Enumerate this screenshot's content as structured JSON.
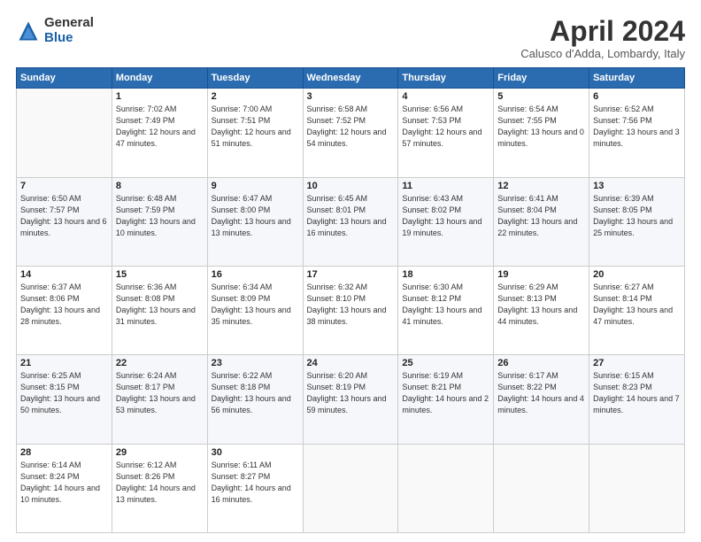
{
  "logo": {
    "general": "General",
    "blue": "Blue"
  },
  "header": {
    "month": "April 2024",
    "location": "Calusco d'Adda, Lombardy, Italy"
  },
  "weekdays": [
    "Sunday",
    "Monday",
    "Tuesday",
    "Wednesday",
    "Thursday",
    "Friday",
    "Saturday"
  ],
  "weeks": [
    [
      {
        "day": "",
        "sunrise": "",
        "sunset": "",
        "daylight": ""
      },
      {
        "day": "1",
        "sunrise": "Sunrise: 7:02 AM",
        "sunset": "Sunset: 7:49 PM",
        "daylight": "Daylight: 12 hours and 47 minutes."
      },
      {
        "day": "2",
        "sunrise": "Sunrise: 7:00 AM",
        "sunset": "Sunset: 7:51 PM",
        "daylight": "Daylight: 12 hours and 51 minutes."
      },
      {
        "day": "3",
        "sunrise": "Sunrise: 6:58 AM",
        "sunset": "Sunset: 7:52 PM",
        "daylight": "Daylight: 12 hours and 54 minutes."
      },
      {
        "day": "4",
        "sunrise": "Sunrise: 6:56 AM",
        "sunset": "Sunset: 7:53 PM",
        "daylight": "Daylight: 12 hours and 57 minutes."
      },
      {
        "day": "5",
        "sunrise": "Sunrise: 6:54 AM",
        "sunset": "Sunset: 7:55 PM",
        "daylight": "Daylight: 13 hours and 0 minutes."
      },
      {
        "day": "6",
        "sunrise": "Sunrise: 6:52 AM",
        "sunset": "Sunset: 7:56 PM",
        "daylight": "Daylight: 13 hours and 3 minutes."
      }
    ],
    [
      {
        "day": "7",
        "sunrise": "Sunrise: 6:50 AM",
        "sunset": "Sunset: 7:57 PM",
        "daylight": "Daylight: 13 hours and 6 minutes."
      },
      {
        "day": "8",
        "sunrise": "Sunrise: 6:48 AM",
        "sunset": "Sunset: 7:59 PM",
        "daylight": "Daylight: 13 hours and 10 minutes."
      },
      {
        "day": "9",
        "sunrise": "Sunrise: 6:47 AM",
        "sunset": "Sunset: 8:00 PM",
        "daylight": "Daylight: 13 hours and 13 minutes."
      },
      {
        "day": "10",
        "sunrise": "Sunrise: 6:45 AM",
        "sunset": "Sunset: 8:01 PM",
        "daylight": "Daylight: 13 hours and 16 minutes."
      },
      {
        "day": "11",
        "sunrise": "Sunrise: 6:43 AM",
        "sunset": "Sunset: 8:02 PM",
        "daylight": "Daylight: 13 hours and 19 minutes."
      },
      {
        "day": "12",
        "sunrise": "Sunrise: 6:41 AM",
        "sunset": "Sunset: 8:04 PM",
        "daylight": "Daylight: 13 hours and 22 minutes."
      },
      {
        "day": "13",
        "sunrise": "Sunrise: 6:39 AM",
        "sunset": "Sunset: 8:05 PM",
        "daylight": "Daylight: 13 hours and 25 minutes."
      }
    ],
    [
      {
        "day": "14",
        "sunrise": "Sunrise: 6:37 AM",
        "sunset": "Sunset: 8:06 PM",
        "daylight": "Daylight: 13 hours and 28 minutes."
      },
      {
        "day": "15",
        "sunrise": "Sunrise: 6:36 AM",
        "sunset": "Sunset: 8:08 PM",
        "daylight": "Daylight: 13 hours and 31 minutes."
      },
      {
        "day": "16",
        "sunrise": "Sunrise: 6:34 AM",
        "sunset": "Sunset: 8:09 PM",
        "daylight": "Daylight: 13 hours and 35 minutes."
      },
      {
        "day": "17",
        "sunrise": "Sunrise: 6:32 AM",
        "sunset": "Sunset: 8:10 PM",
        "daylight": "Daylight: 13 hours and 38 minutes."
      },
      {
        "day": "18",
        "sunrise": "Sunrise: 6:30 AM",
        "sunset": "Sunset: 8:12 PM",
        "daylight": "Daylight: 13 hours and 41 minutes."
      },
      {
        "day": "19",
        "sunrise": "Sunrise: 6:29 AM",
        "sunset": "Sunset: 8:13 PM",
        "daylight": "Daylight: 13 hours and 44 minutes."
      },
      {
        "day": "20",
        "sunrise": "Sunrise: 6:27 AM",
        "sunset": "Sunset: 8:14 PM",
        "daylight": "Daylight: 13 hours and 47 minutes."
      }
    ],
    [
      {
        "day": "21",
        "sunrise": "Sunrise: 6:25 AM",
        "sunset": "Sunset: 8:15 PM",
        "daylight": "Daylight: 13 hours and 50 minutes."
      },
      {
        "day": "22",
        "sunrise": "Sunrise: 6:24 AM",
        "sunset": "Sunset: 8:17 PM",
        "daylight": "Daylight: 13 hours and 53 minutes."
      },
      {
        "day": "23",
        "sunrise": "Sunrise: 6:22 AM",
        "sunset": "Sunset: 8:18 PM",
        "daylight": "Daylight: 13 hours and 56 minutes."
      },
      {
        "day": "24",
        "sunrise": "Sunrise: 6:20 AM",
        "sunset": "Sunset: 8:19 PM",
        "daylight": "Daylight: 13 hours and 59 minutes."
      },
      {
        "day": "25",
        "sunrise": "Sunrise: 6:19 AM",
        "sunset": "Sunset: 8:21 PM",
        "daylight": "Daylight: 14 hours and 2 minutes."
      },
      {
        "day": "26",
        "sunrise": "Sunrise: 6:17 AM",
        "sunset": "Sunset: 8:22 PM",
        "daylight": "Daylight: 14 hours and 4 minutes."
      },
      {
        "day": "27",
        "sunrise": "Sunrise: 6:15 AM",
        "sunset": "Sunset: 8:23 PM",
        "daylight": "Daylight: 14 hours and 7 minutes."
      }
    ],
    [
      {
        "day": "28",
        "sunrise": "Sunrise: 6:14 AM",
        "sunset": "Sunset: 8:24 PM",
        "daylight": "Daylight: 14 hours and 10 minutes."
      },
      {
        "day": "29",
        "sunrise": "Sunrise: 6:12 AM",
        "sunset": "Sunset: 8:26 PM",
        "daylight": "Daylight: 14 hours and 13 minutes."
      },
      {
        "day": "30",
        "sunrise": "Sunrise: 6:11 AM",
        "sunset": "Sunset: 8:27 PM",
        "daylight": "Daylight: 14 hours and 16 minutes."
      },
      {
        "day": "",
        "sunrise": "",
        "sunset": "",
        "daylight": ""
      },
      {
        "day": "",
        "sunrise": "",
        "sunset": "",
        "daylight": ""
      },
      {
        "day": "",
        "sunrise": "",
        "sunset": "",
        "daylight": ""
      },
      {
        "day": "",
        "sunrise": "",
        "sunset": "",
        "daylight": ""
      }
    ]
  ]
}
